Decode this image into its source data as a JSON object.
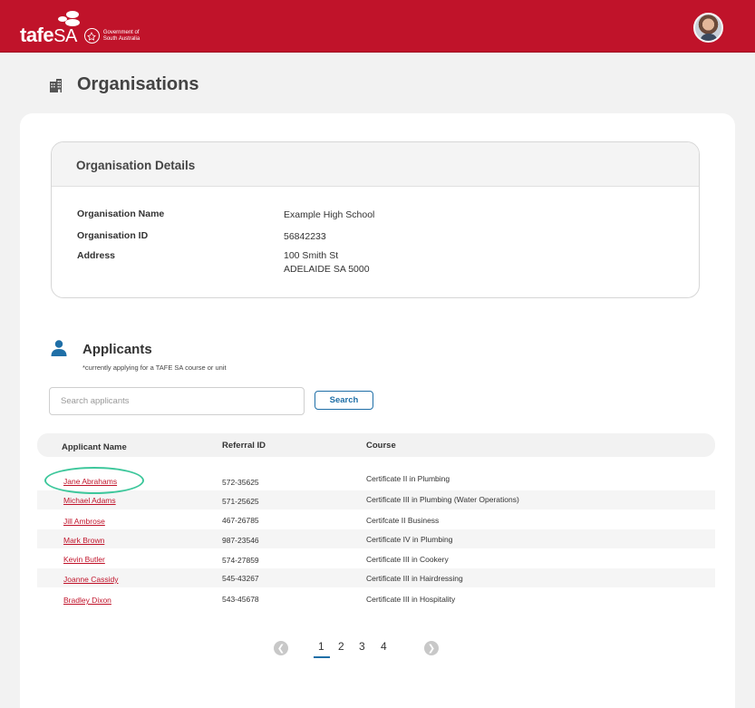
{
  "header": {
    "logo_main": "tafe",
    "logo_suffix": "SA",
    "gov_line1": "Government of",
    "gov_line2": "South Australia",
    "brand_color": "#c0132a"
  },
  "page": {
    "title": "Organisations",
    "icon": "building-icon"
  },
  "org_details": {
    "heading": "Organisation Details",
    "fields": [
      {
        "label": "Organisation Name",
        "value": "Example High School"
      },
      {
        "label": "Organisation ID",
        "value": "56842233"
      },
      {
        "label": "Address",
        "value": "100 Smith St",
        "value2": "ADELAIDE SA 5000"
      }
    ]
  },
  "applicants": {
    "title": "Applicants",
    "subtitle": "*currently applying for a TAFE SA course or unit",
    "search_placeholder": "Search applicants",
    "search_button": "Search",
    "columns": [
      "Applicant Name",
      "Referral ID",
      "Course"
    ],
    "rows": [
      {
        "name": "Jane Abrahams",
        "referral": "572-35625",
        "course": "Certificate II in Plumbing"
      },
      {
        "name": "Michael Adams",
        "referral": "571-25625",
        "course": "Certificate III in Plumbing (Water Operations)"
      },
      {
        "name": "Jill Ambrose",
        "referral": "467-26785",
        "course": "Certifcate II Business"
      },
      {
        "name": "Mark Brown",
        "referral": "987-23546",
        "course": "Certificate IV in Plumbing"
      },
      {
        "name": "Kevin Butler",
        "referral": "574-27859",
        "course": "Certificate III in Cookery"
      },
      {
        "name": "Joanne Cassidy",
        "referral": "545-43267",
        "course": "Certificate III in Hairdressing"
      },
      {
        "name": "Bradley Dixon",
        "referral": "543-45678",
        "course": "Certificate III in Hospitality"
      }
    ]
  },
  "pagination": {
    "pages": [
      "1",
      "2",
      "3",
      "4"
    ],
    "current": "1",
    "accent": "#1f6fa7"
  }
}
